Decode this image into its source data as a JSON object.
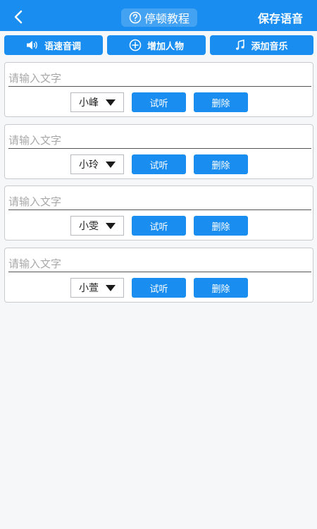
{
  "header": {
    "tutorial_label": "停顿教程",
    "save_label": "保存语音"
  },
  "toolbar": [
    {
      "label": "语速音调",
      "icon": "speaker-icon"
    },
    {
      "label": "增加人物",
      "icon": "plus-circle-icon"
    },
    {
      "label": "添加音乐",
      "icon": "music-note-icon"
    }
  ],
  "entries": [
    {
      "placeholder": "请输入文字",
      "speaker": "小峰",
      "listen_label": "试听",
      "delete_label": "删除"
    },
    {
      "placeholder": "请输入文字",
      "speaker": "小玲",
      "listen_label": "试听",
      "delete_label": "删除"
    },
    {
      "placeholder": "请输入文字",
      "speaker": "小雯",
      "listen_label": "试听",
      "delete_label": "删除"
    },
    {
      "placeholder": "请输入文字",
      "speaker": "小萱",
      "listen_label": "试听",
      "delete_label": "删除"
    }
  ],
  "colors": {
    "accent": "#1a8ef0",
    "background": "#f6f7f8"
  }
}
